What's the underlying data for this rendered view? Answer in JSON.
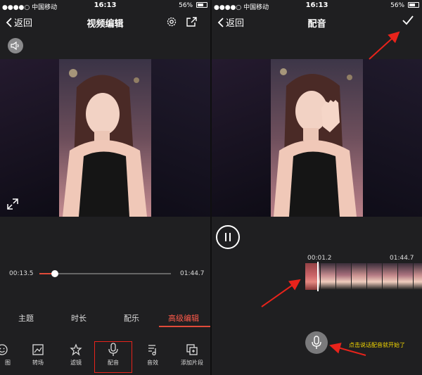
{
  "status_bar": {
    "carrier": "●●●●○ 中国移动",
    "time": "16:13",
    "battery": "56%"
  },
  "left_screen": {
    "back_label": "返回",
    "title": "视频编辑",
    "current_time": "00:13.5",
    "total_time": "01:44.7",
    "playback_progress": 0.12,
    "tabs": [
      "主题",
      "时长",
      "配乐",
      "高级编辑"
    ],
    "active_tab": "高级编辑",
    "tools": [
      {
        "label": "图",
        "icon": "emoji-icon"
      },
      {
        "label": "转场",
        "icon": "transition-icon"
      },
      {
        "label": "滤镜",
        "icon": "filter-icon"
      },
      {
        "label": "配音",
        "icon": "mic-icon"
      },
      {
        "label": "音效",
        "icon": "sound-effect-icon"
      },
      {
        "label": "添加片段",
        "icon": "add-clip-icon"
      }
    ],
    "highlighted_tool": "配音"
  },
  "right_screen": {
    "back_label": "返回",
    "title": "配音",
    "recorded_time": "00:01.2",
    "total_time": "01:44.7",
    "annotation": "点击说话配音就开始了"
  },
  "colors": {
    "accent": "#e14b3a",
    "annotation_text": "#f5d800",
    "arrow": "#e8231b"
  }
}
